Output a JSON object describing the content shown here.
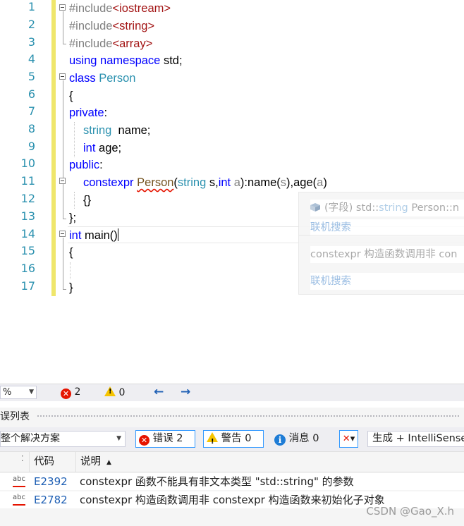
{
  "editor": {
    "line_numbers": [
      "1",
      "2",
      "3",
      "4",
      "5",
      "6",
      "7",
      "8",
      "9",
      "10",
      "11",
      "12",
      "13",
      "14",
      "15",
      "16",
      "17"
    ],
    "code": {
      "l1_pp": "#include",
      "l1_inc": "<iostream>",
      "l2_pp": "#include",
      "l2_inc": "<string>",
      "l3_pp": "#include",
      "l3_inc": "<array>",
      "l4_kw1": "using",
      "l4_kw2": "namespace",
      "l4_rest": " std;",
      "l5_kw": "class",
      "l5_ty": "Person",
      "l6": "{",
      "l7_kw": "private",
      "l7_rest": ":",
      "l8_ty": "string",
      "l8_rest": "  name;",
      "l9_kw": "int",
      "l9_rest": " age;",
      "l10_kw": "public",
      "l10_rest": ":",
      "l11_kw": "constexpr",
      "l11_fn": "Person",
      "l11_p1": "(",
      "l11_ty": "string",
      "l11_s": " s,",
      "l11_kw2": "int",
      "l11_a": " a",
      "l11_rest1": "):name(",
      "l11_s2": "s",
      "l11_rest2": "),age(",
      "l11_a2": "a",
      "l11_rest3": ")",
      "l12": "{}",
      "l13": "};",
      "l14_kw": "int",
      "l14_rest": " main()",
      "l15": "{",
      "l17": "}"
    }
  },
  "quick_info": {
    "signature_prefix": "(字段) std::",
    "signature_type": "string",
    "signature_rest": " Person::n",
    "online_search_1": "联机搜索",
    "error_text": "constexpr 构造函数调用非 con",
    "online_search_2": "联机搜索"
  },
  "status_bar": {
    "zoom": "%",
    "errors": "2",
    "warnings": "0"
  },
  "error_list": {
    "title": "误列表",
    "scope": "整个解决方案",
    "errors_label": "错误 2",
    "warnings_label": "警告 0",
    "messages_label": "消息 0",
    "build_source": "生成 + IntelliSense",
    "columns": {
      "code": "代码",
      "description": "说明"
    },
    "rows": [
      {
        "code": "E2392",
        "description": "constexpr 函数不能具有非文本类型 \"std::string\" 的参数"
      },
      {
        "code": "E2782",
        "description": "constexpr 构造函数调用非 constexpr 构造函数来初始化子对象"
      }
    ]
  },
  "watermark": "CSDN @Gao_X.h",
  "colors": {
    "keyword": "#0000ff",
    "type": "#2b91af",
    "preprocessor": "#808080",
    "include_path": "#a31515",
    "error": "#e51400",
    "change_bar": "#efe66b"
  }
}
